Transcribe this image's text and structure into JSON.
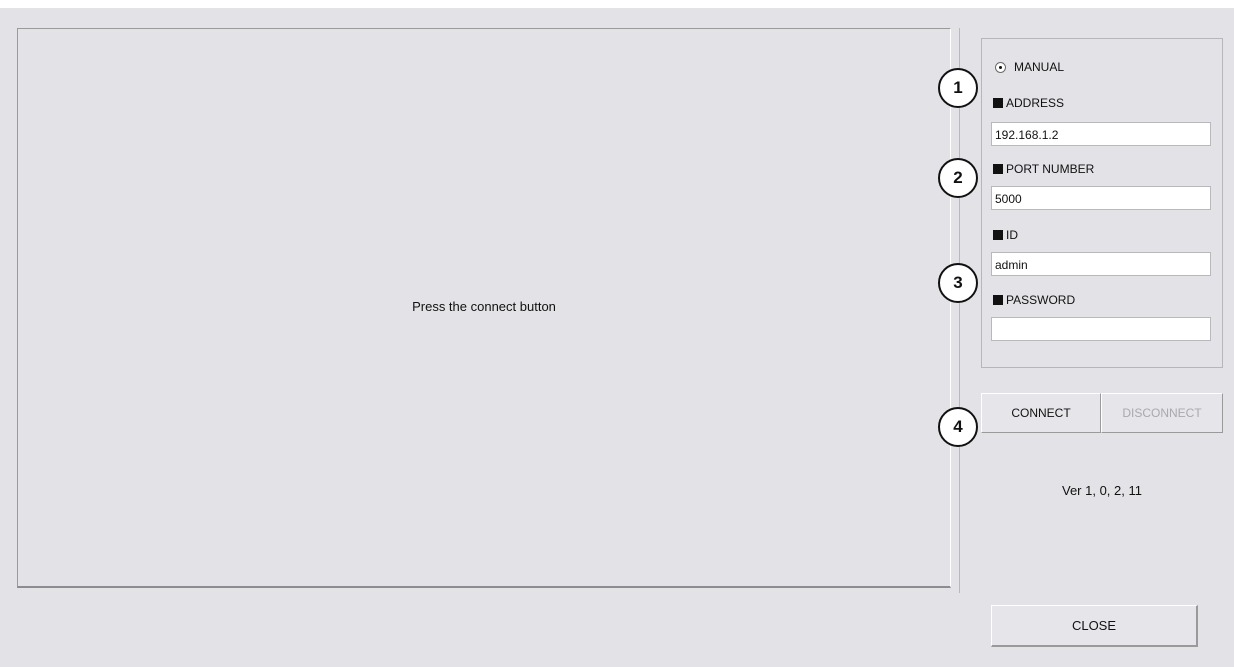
{
  "video": {
    "message": "Press the connect button"
  },
  "settings": {
    "mode_label": "MANUAL",
    "address": {
      "label": "ADDRESS",
      "value": "192.168.1.2"
    },
    "port": {
      "label": "PORT NUMBER",
      "value": "5000"
    },
    "id": {
      "label": "ID",
      "value": "admin"
    },
    "password": {
      "label": "PASSWORD",
      "value": ""
    }
  },
  "buttons": {
    "connect": "CONNECT",
    "disconnect": "DISCONNECT",
    "close": "CLOSE"
  },
  "version": "Ver 1, 0, 2, 11",
  "callouts": [
    "1",
    "2",
    "3",
    "4"
  ]
}
